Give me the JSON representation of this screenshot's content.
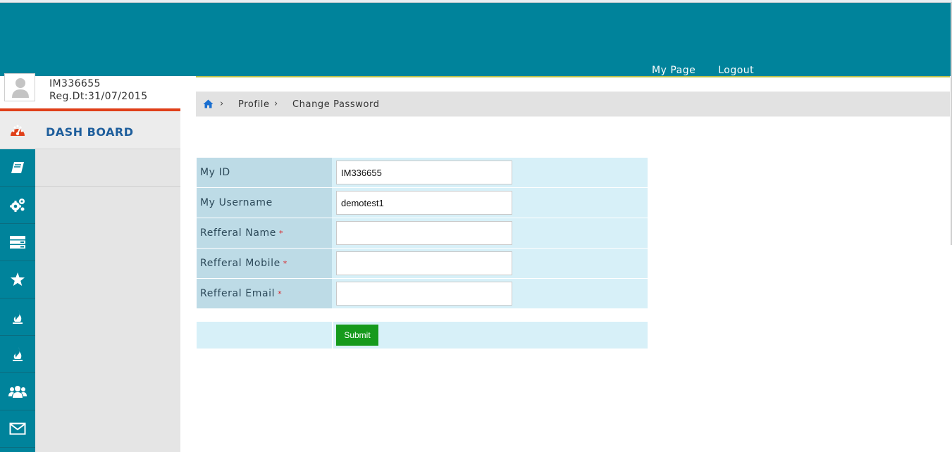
{
  "header": {
    "nav": {
      "my_page": "My Page",
      "logout": "Logout"
    },
    "colors": {
      "primary": "#00839b",
      "accent": "#e0401a"
    }
  },
  "sidebar": {
    "profile": {
      "user_id": "IM336655",
      "reg_date": "Reg.Dt:31/07/2015"
    },
    "dashboard_label": "DASH BOARD",
    "icons": [
      "book-icon",
      "gears-icon",
      "server-icon",
      "star-icon",
      "fire-icon",
      "fire-icon",
      "users-icon",
      "envelope-icon"
    ]
  },
  "breadcrumb": {
    "items": [
      "Profile",
      "Change Password"
    ],
    "separator": "›"
  },
  "form": {
    "fields": [
      {
        "label": "My ID",
        "required": false,
        "value": "IM336655"
      },
      {
        "label": "My Username",
        "required": false,
        "value": "demotest1"
      },
      {
        "label": "Refferal Name",
        "required": true,
        "value": ""
      },
      {
        "label": "Refferal Mobile",
        "required": true,
        "value": ""
      },
      {
        "label": "Refferal Email",
        "required": true,
        "value": ""
      }
    ],
    "required_mark": "*",
    "submit_label": "Submit"
  }
}
